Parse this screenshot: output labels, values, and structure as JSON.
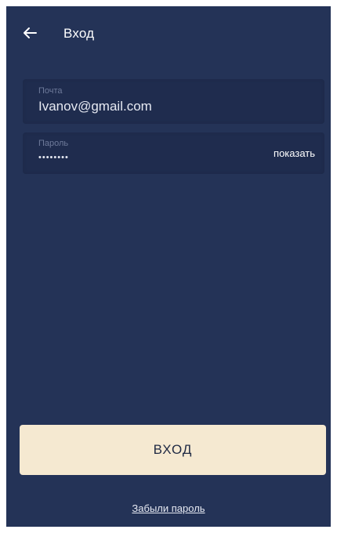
{
  "header": {
    "title": "Вход",
    "back_icon": "arrow-left-icon"
  },
  "form": {
    "email": {
      "label": "Почта",
      "value": "Ivanov@gmail.com"
    },
    "password": {
      "label": "Пароль",
      "value": "••••••••",
      "toggle_label": "показать"
    }
  },
  "actions": {
    "login_label": "ВХОД",
    "forgot_label": "Забыли пароль"
  },
  "colors": {
    "background": "#243357",
    "field_background": "#1f2c4e",
    "button_background": "#f5e9d1",
    "text": "#ffffff"
  }
}
